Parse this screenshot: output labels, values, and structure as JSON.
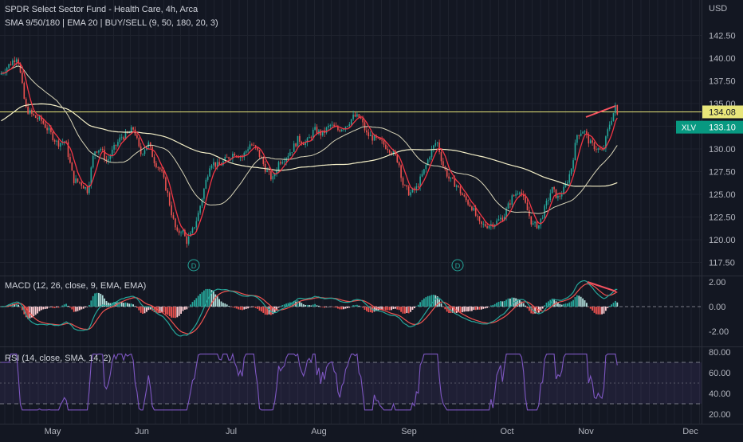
{
  "header": {
    "title": "SPDR Select Sector Fund - Health Care, 4h, Arca",
    "indicator_line": "SMA 9/50/180 | EMA 20 | BUY/SELL (9, 50, 180, 20, 3)"
  },
  "currency": "USD",
  "main_pane": {
    "y_ticks": [
      "142.50",
      "140.00",
      "137.50",
      "135.00",
      "132.50",
      "130.00",
      "127.50",
      "125.00",
      "122.50",
      "120.00",
      "117.50"
    ],
    "resistance_label": "134.08",
    "symbol_tag": "XLV",
    "last_price": "133.10",
    "dividend_marker": "D"
  },
  "macd_pane": {
    "title": "MACD (12, 26, close, 9, EMA, EMA)",
    "y_ticks": [
      "2.00",
      "0.00",
      "-2.00"
    ]
  },
  "rsi_pane": {
    "title": "RSI (14, close, SMA, 14, 2)",
    "y_ticks": [
      "80.00",
      "60.00",
      "40.00",
      "20.00"
    ]
  },
  "x_axis": {
    "months": [
      "May",
      "Jun",
      "Jul",
      "Aug",
      "Sep",
      "Oct",
      "Nov",
      "Dec"
    ]
  },
  "colors": {
    "background": "#131722",
    "up": "#26a69a",
    "down": "#ef5350",
    "sma_fast": "#f23645",
    "sma_mid": "#e0dcc0",
    "sma_slow": "#f5f0c8",
    "resistance": "#e8e67a",
    "rsi_line": "#7e57c2",
    "macd_line": "#26a69a",
    "signal_line": "#ef5350"
  }
}
